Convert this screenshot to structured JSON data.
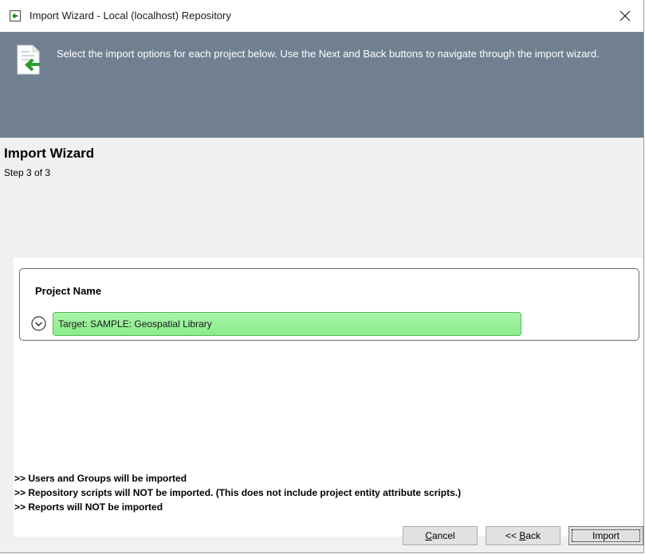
{
  "window": {
    "title": "Import Wizard - Local  (localhost) Repository",
    "close_glyph": "✕"
  },
  "banner": {
    "icon": "import-document-icon",
    "text": "Select the import options for each project below. Use the Next and Back buttons to navigate through the import wizard."
  },
  "wizard": {
    "title": "Import Wizard",
    "step": "Step 3 of 3"
  },
  "projects": {
    "header": "Project Name",
    "items": [
      {
        "label": "Target: SAMPLE: Geospatial Library",
        "expand_icon": "chevron-down-circle-icon"
      }
    ]
  },
  "notes": [
    ">> Users and Groups will be imported",
    ">> Repository scripts will NOT be imported. (This does not include project entity attribute scripts.)",
    ">> Reports will NOT be imported"
  ],
  "buttons": {
    "cancel": {
      "accel": "C",
      "rest": "ancel"
    },
    "back": {
      "prefix": "<< ",
      "accel": "B",
      "rest": "ack"
    },
    "import": {
      "label": "Import"
    }
  },
  "colors": {
    "banner_bg": "#708090",
    "project_bar": "#95ef95"
  }
}
